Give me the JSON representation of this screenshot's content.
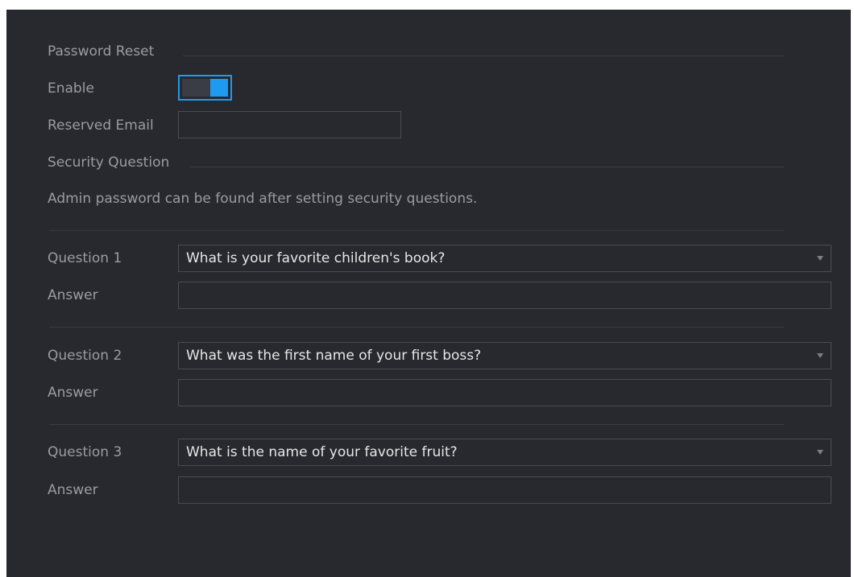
{
  "password_reset": {
    "section_title": "Password Reset",
    "enable_label": "Enable",
    "enable_value": true,
    "reserved_email_label": "Reserved Email",
    "reserved_email_value": ""
  },
  "security_question": {
    "section_title": "Security Question",
    "hint": "Admin password can be found after setting security questions.",
    "questions": [
      {
        "label": "Question 1",
        "value": "What is your favorite children's book?",
        "answer_label": "Answer",
        "answer_value": ""
      },
      {
        "label": "Question 2",
        "value": "What was the first name of your first boss?",
        "answer_label": "Answer",
        "answer_value": ""
      },
      {
        "label": "Question 3",
        "value": "What is the name of your favorite fruit?",
        "answer_label": "Answer",
        "answer_value": ""
      }
    ]
  },
  "colors": {
    "accent": "#1e9bf0",
    "panel_bg": "#27292f"
  }
}
